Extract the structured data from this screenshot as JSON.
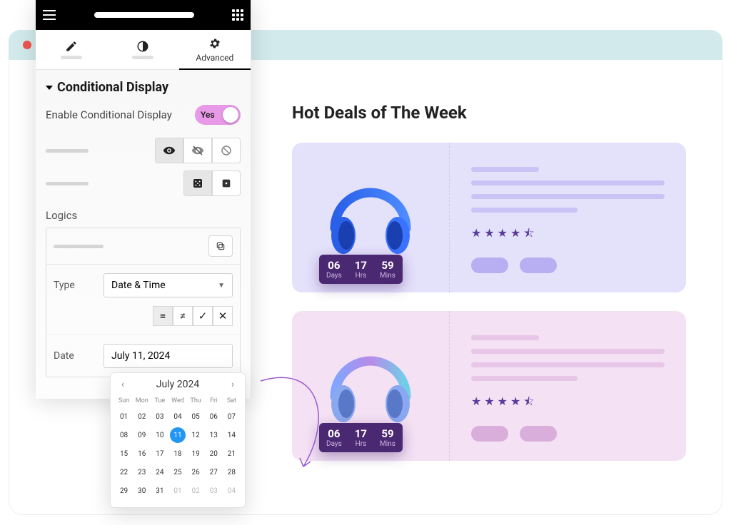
{
  "chrome": {
    "traffic": [
      "#ef5350",
      "#fbc02d",
      "#66bb6a"
    ]
  },
  "sidebar": {
    "tabs": {
      "advanced": "Advanced"
    },
    "section": {
      "title": "Conditional Display",
      "enable_label": "Enable Conditional Display",
      "toggle_text": "Yes"
    },
    "logics": {
      "label": "Logics",
      "type_label": "Type",
      "type_value": "Date & Time",
      "operators": [
        "=",
        "≠",
        "✓",
        "✕"
      ],
      "date_label": "Date",
      "date_value": "July 11, 2024"
    }
  },
  "calendar": {
    "month": "July 2024",
    "dow": [
      "Sun",
      "Mon",
      "Tue",
      "Wed",
      "Thu",
      "Fri",
      "Sat"
    ],
    "days": [
      {
        "n": "01"
      },
      {
        "n": "02"
      },
      {
        "n": "03"
      },
      {
        "n": "04"
      },
      {
        "n": "05"
      },
      {
        "n": "06"
      },
      {
        "n": "07"
      },
      {
        "n": "08"
      },
      {
        "n": "09"
      },
      {
        "n": "10"
      },
      {
        "n": "11",
        "sel": true
      },
      {
        "n": "12"
      },
      {
        "n": "13"
      },
      {
        "n": "14"
      },
      {
        "n": "15"
      },
      {
        "n": "16"
      },
      {
        "n": "17"
      },
      {
        "n": "18"
      },
      {
        "n": "19"
      },
      {
        "n": "20"
      },
      {
        "n": "21"
      },
      {
        "n": "22"
      },
      {
        "n": "23"
      },
      {
        "n": "24"
      },
      {
        "n": "25"
      },
      {
        "n": "26"
      },
      {
        "n": "27"
      },
      {
        "n": "28"
      },
      {
        "n": "29"
      },
      {
        "n": "30"
      },
      {
        "n": "31"
      },
      {
        "n": "01",
        "muted": true
      },
      {
        "n": "02",
        "muted": true
      },
      {
        "n": "03",
        "muted": true
      },
      {
        "n": "04",
        "muted": true
      }
    ]
  },
  "content": {
    "title": "Hot Deals of The Week",
    "countdown": {
      "days_n": "06",
      "days_l": "Days",
      "hrs_n": "17",
      "hrs_l": "Hrs",
      "mins_n": "59",
      "mins_l": "Mins"
    }
  }
}
